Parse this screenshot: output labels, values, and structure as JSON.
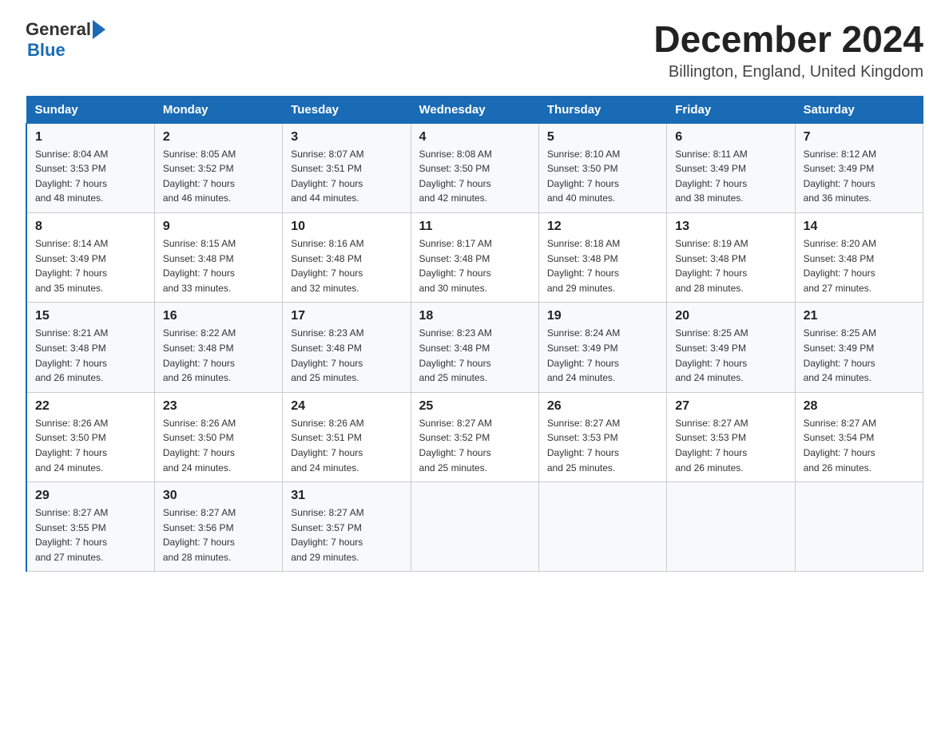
{
  "header": {
    "logo_general": "General",
    "logo_blue": "Blue",
    "title": "December 2024",
    "subtitle": "Billington, England, United Kingdom"
  },
  "days_of_week": [
    "Sunday",
    "Monday",
    "Tuesday",
    "Wednesday",
    "Thursday",
    "Friday",
    "Saturday"
  ],
  "weeks": [
    [
      {
        "day": "1",
        "sunrise": "8:04 AM",
        "sunset": "3:53 PM",
        "daylight": "7 hours and 48 minutes."
      },
      {
        "day": "2",
        "sunrise": "8:05 AM",
        "sunset": "3:52 PM",
        "daylight": "7 hours and 46 minutes."
      },
      {
        "day": "3",
        "sunrise": "8:07 AM",
        "sunset": "3:51 PM",
        "daylight": "7 hours and 44 minutes."
      },
      {
        "day": "4",
        "sunrise": "8:08 AM",
        "sunset": "3:50 PM",
        "daylight": "7 hours and 42 minutes."
      },
      {
        "day": "5",
        "sunrise": "8:10 AM",
        "sunset": "3:50 PM",
        "daylight": "7 hours and 40 minutes."
      },
      {
        "day": "6",
        "sunrise": "8:11 AM",
        "sunset": "3:49 PM",
        "daylight": "7 hours and 38 minutes."
      },
      {
        "day": "7",
        "sunrise": "8:12 AM",
        "sunset": "3:49 PM",
        "daylight": "7 hours and 36 minutes."
      }
    ],
    [
      {
        "day": "8",
        "sunrise": "8:14 AM",
        "sunset": "3:49 PM",
        "daylight": "7 hours and 35 minutes."
      },
      {
        "day": "9",
        "sunrise": "8:15 AM",
        "sunset": "3:48 PM",
        "daylight": "7 hours and 33 minutes."
      },
      {
        "day": "10",
        "sunrise": "8:16 AM",
        "sunset": "3:48 PM",
        "daylight": "7 hours and 32 minutes."
      },
      {
        "day": "11",
        "sunrise": "8:17 AM",
        "sunset": "3:48 PM",
        "daylight": "7 hours and 30 minutes."
      },
      {
        "day": "12",
        "sunrise": "8:18 AM",
        "sunset": "3:48 PM",
        "daylight": "7 hours and 29 minutes."
      },
      {
        "day": "13",
        "sunrise": "8:19 AM",
        "sunset": "3:48 PM",
        "daylight": "7 hours and 28 minutes."
      },
      {
        "day": "14",
        "sunrise": "8:20 AM",
        "sunset": "3:48 PM",
        "daylight": "7 hours and 27 minutes."
      }
    ],
    [
      {
        "day": "15",
        "sunrise": "8:21 AM",
        "sunset": "3:48 PM",
        "daylight": "7 hours and 26 minutes."
      },
      {
        "day": "16",
        "sunrise": "8:22 AM",
        "sunset": "3:48 PM",
        "daylight": "7 hours and 26 minutes."
      },
      {
        "day": "17",
        "sunrise": "8:23 AM",
        "sunset": "3:48 PM",
        "daylight": "7 hours and 25 minutes."
      },
      {
        "day": "18",
        "sunrise": "8:23 AM",
        "sunset": "3:48 PM",
        "daylight": "7 hours and 25 minutes."
      },
      {
        "day": "19",
        "sunrise": "8:24 AM",
        "sunset": "3:49 PM",
        "daylight": "7 hours and 24 minutes."
      },
      {
        "day": "20",
        "sunrise": "8:25 AM",
        "sunset": "3:49 PM",
        "daylight": "7 hours and 24 minutes."
      },
      {
        "day": "21",
        "sunrise": "8:25 AM",
        "sunset": "3:49 PM",
        "daylight": "7 hours and 24 minutes."
      }
    ],
    [
      {
        "day": "22",
        "sunrise": "8:26 AM",
        "sunset": "3:50 PM",
        "daylight": "7 hours and 24 minutes."
      },
      {
        "day": "23",
        "sunrise": "8:26 AM",
        "sunset": "3:50 PM",
        "daylight": "7 hours and 24 minutes."
      },
      {
        "day": "24",
        "sunrise": "8:26 AM",
        "sunset": "3:51 PM",
        "daylight": "7 hours and 24 minutes."
      },
      {
        "day": "25",
        "sunrise": "8:27 AM",
        "sunset": "3:52 PM",
        "daylight": "7 hours and 25 minutes."
      },
      {
        "day": "26",
        "sunrise": "8:27 AM",
        "sunset": "3:53 PM",
        "daylight": "7 hours and 25 minutes."
      },
      {
        "day": "27",
        "sunrise": "8:27 AM",
        "sunset": "3:53 PM",
        "daylight": "7 hours and 26 minutes."
      },
      {
        "day": "28",
        "sunrise": "8:27 AM",
        "sunset": "3:54 PM",
        "daylight": "7 hours and 26 minutes."
      }
    ],
    [
      {
        "day": "29",
        "sunrise": "8:27 AM",
        "sunset": "3:55 PM",
        "daylight": "7 hours and 27 minutes."
      },
      {
        "day": "30",
        "sunrise": "8:27 AM",
        "sunset": "3:56 PM",
        "daylight": "7 hours and 28 minutes."
      },
      {
        "day": "31",
        "sunrise": "8:27 AM",
        "sunset": "3:57 PM",
        "daylight": "7 hours and 29 minutes."
      },
      null,
      null,
      null,
      null
    ]
  ],
  "labels": {
    "sunrise_prefix": "Sunrise: ",
    "sunset_prefix": "Sunset: ",
    "daylight_prefix": "Daylight: "
  }
}
